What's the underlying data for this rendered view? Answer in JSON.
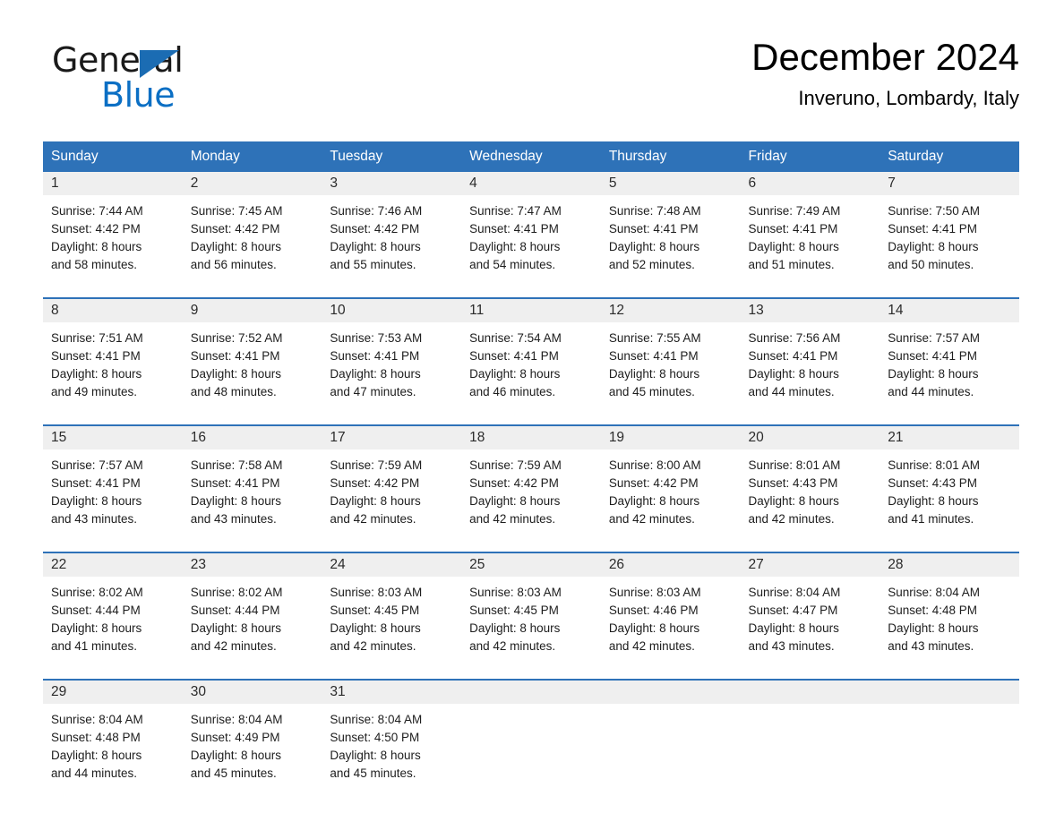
{
  "brand": {
    "name_part1": "General",
    "name_part2": "Blue",
    "triangle_color": "#1b6cb3",
    "blue_color": "#0b6fc4"
  },
  "header": {
    "title": "December 2024",
    "subtitle": "Inveruno, Lombardy, Italy"
  },
  "theme": {
    "header_blue": "#2e72b8",
    "daynum_band": "#efefef",
    "text": "#1d1d1d"
  },
  "weekday_headers": [
    "Sunday",
    "Monday",
    "Tuesday",
    "Wednesday",
    "Thursday",
    "Friday",
    "Saturday"
  ],
  "weeks": [
    {
      "days": [
        {
          "num": "1",
          "sunrise": "Sunrise: 7:44 AM",
          "sunset": "Sunset: 4:42 PM",
          "daylight1": "Daylight: 8 hours",
          "daylight2": "and 58 minutes."
        },
        {
          "num": "2",
          "sunrise": "Sunrise: 7:45 AM",
          "sunset": "Sunset: 4:42 PM",
          "daylight1": "Daylight: 8 hours",
          "daylight2": "and 56 minutes."
        },
        {
          "num": "3",
          "sunrise": "Sunrise: 7:46 AM",
          "sunset": "Sunset: 4:42 PM",
          "daylight1": "Daylight: 8 hours",
          "daylight2": "and 55 minutes."
        },
        {
          "num": "4",
          "sunrise": "Sunrise: 7:47 AM",
          "sunset": "Sunset: 4:41 PM",
          "daylight1": "Daylight: 8 hours",
          "daylight2": "and 54 minutes."
        },
        {
          "num": "5",
          "sunrise": "Sunrise: 7:48 AM",
          "sunset": "Sunset: 4:41 PM",
          "daylight1": "Daylight: 8 hours",
          "daylight2": "and 52 minutes."
        },
        {
          "num": "6",
          "sunrise": "Sunrise: 7:49 AM",
          "sunset": "Sunset: 4:41 PM",
          "daylight1": "Daylight: 8 hours",
          "daylight2": "and 51 minutes."
        },
        {
          "num": "7",
          "sunrise": "Sunrise: 7:50 AM",
          "sunset": "Sunset: 4:41 PM",
          "daylight1": "Daylight: 8 hours",
          "daylight2": "and 50 minutes."
        }
      ]
    },
    {
      "days": [
        {
          "num": "8",
          "sunrise": "Sunrise: 7:51 AM",
          "sunset": "Sunset: 4:41 PM",
          "daylight1": "Daylight: 8 hours",
          "daylight2": "and 49 minutes."
        },
        {
          "num": "9",
          "sunrise": "Sunrise: 7:52 AM",
          "sunset": "Sunset: 4:41 PM",
          "daylight1": "Daylight: 8 hours",
          "daylight2": "and 48 minutes."
        },
        {
          "num": "10",
          "sunrise": "Sunrise: 7:53 AM",
          "sunset": "Sunset: 4:41 PM",
          "daylight1": "Daylight: 8 hours",
          "daylight2": "and 47 minutes."
        },
        {
          "num": "11",
          "sunrise": "Sunrise: 7:54 AM",
          "sunset": "Sunset: 4:41 PM",
          "daylight1": "Daylight: 8 hours",
          "daylight2": "and 46 minutes."
        },
        {
          "num": "12",
          "sunrise": "Sunrise: 7:55 AM",
          "sunset": "Sunset: 4:41 PM",
          "daylight1": "Daylight: 8 hours",
          "daylight2": "and 45 minutes."
        },
        {
          "num": "13",
          "sunrise": "Sunrise: 7:56 AM",
          "sunset": "Sunset: 4:41 PM",
          "daylight1": "Daylight: 8 hours",
          "daylight2": "and 44 minutes."
        },
        {
          "num": "14",
          "sunrise": "Sunrise: 7:57 AM",
          "sunset": "Sunset: 4:41 PM",
          "daylight1": "Daylight: 8 hours",
          "daylight2": "and 44 minutes."
        }
      ]
    },
    {
      "days": [
        {
          "num": "15",
          "sunrise": "Sunrise: 7:57 AM",
          "sunset": "Sunset: 4:41 PM",
          "daylight1": "Daylight: 8 hours",
          "daylight2": "and 43 minutes."
        },
        {
          "num": "16",
          "sunrise": "Sunrise: 7:58 AM",
          "sunset": "Sunset: 4:41 PM",
          "daylight1": "Daylight: 8 hours",
          "daylight2": "and 43 minutes."
        },
        {
          "num": "17",
          "sunrise": "Sunrise: 7:59 AM",
          "sunset": "Sunset: 4:42 PM",
          "daylight1": "Daylight: 8 hours",
          "daylight2": "and 42 minutes."
        },
        {
          "num": "18",
          "sunrise": "Sunrise: 7:59 AM",
          "sunset": "Sunset: 4:42 PM",
          "daylight1": "Daylight: 8 hours",
          "daylight2": "and 42 minutes."
        },
        {
          "num": "19",
          "sunrise": "Sunrise: 8:00 AM",
          "sunset": "Sunset: 4:42 PM",
          "daylight1": "Daylight: 8 hours",
          "daylight2": "and 42 minutes."
        },
        {
          "num": "20",
          "sunrise": "Sunrise: 8:01 AM",
          "sunset": "Sunset: 4:43 PM",
          "daylight1": "Daylight: 8 hours",
          "daylight2": "and 42 minutes."
        },
        {
          "num": "21",
          "sunrise": "Sunrise: 8:01 AM",
          "sunset": "Sunset: 4:43 PM",
          "daylight1": "Daylight: 8 hours",
          "daylight2": "and 41 minutes."
        }
      ]
    },
    {
      "days": [
        {
          "num": "22",
          "sunrise": "Sunrise: 8:02 AM",
          "sunset": "Sunset: 4:44 PM",
          "daylight1": "Daylight: 8 hours",
          "daylight2": "and 41 minutes."
        },
        {
          "num": "23",
          "sunrise": "Sunrise: 8:02 AM",
          "sunset": "Sunset: 4:44 PM",
          "daylight1": "Daylight: 8 hours",
          "daylight2": "and 42 minutes."
        },
        {
          "num": "24",
          "sunrise": "Sunrise: 8:03 AM",
          "sunset": "Sunset: 4:45 PM",
          "daylight1": "Daylight: 8 hours",
          "daylight2": "and 42 minutes."
        },
        {
          "num": "25",
          "sunrise": "Sunrise: 8:03 AM",
          "sunset": "Sunset: 4:45 PM",
          "daylight1": "Daylight: 8 hours",
          "daylight2": "and 42 minutes."
        },
        {
          "num": "26",
          "sunrise": "Sunrise: 8:03 AM",
          "sunset": "Sunset: 4:46 PM",
          "daylight1": "Daylight: 8 hours",
          "daylight2": "and 42 minutes."
        },
        {
          "num": "27",
          "sunrise": "Sunrise: 8:04 AM",
          "sunset": "Sunset: 4:47 PM",
          "daylight1": "Daylight: 8 hours",
          "daylight2": "and 43 minutes."
        },
        {
          "num": "28",
          "sunrise": "Sunrise: 8:04 AM",
          "sunset": "Sunset: 4:48 PM",
          "daylight1": "Daylight: 8 hours",
          "daylight2": "and 43 minutes."
        }
      ]
    },
    {
      "days": [
        {
          "num": "29",
          "sunrise": "Sunrise: 8:04 AM",
          "sunset": "Sunset: 4:48 PM",
          "daylight1": "Daylight: 8 hours",
          "daylight2": "and 44 minutes."
        },
        {
          "num": "30",
          "sunrise": "Sunrise: 8:04 AM",
          "sunset": "Sunset: 4:49 PM",
          "daylight1": "Daylight: 8 hours",
          "daylight2": "and 45 minutes."
        },
        {
          "num": "31",
          "sunrise": "Sunrise: 8:04 AM",
          "sunset": "Sunset: 4:50 PM",
          "daylight1": "Daylight: 8 hours",
          "daylight2": "and 45 minutes."
        },
        {
          "num": "",
          "sunrise": "",
          "sunset": "",
          "daylight1": "",
          "daylight2": ""
        },
        {
          "num": "",
          "sunrise": "",
          "sunset": "",
          "daylight1": "",
          "daylight2": ""
        },
        {
          "num": "",
          "sunrise": "",
          "sunset": "",
          "daylight1": "",
          "daylight2": ""
        },
        {
          "num": "",
          "sunrise": "",
          "sunset": "",
          "daylight1": "",
          "daylight2": ""
        }
      ]
    }
  ]
}
